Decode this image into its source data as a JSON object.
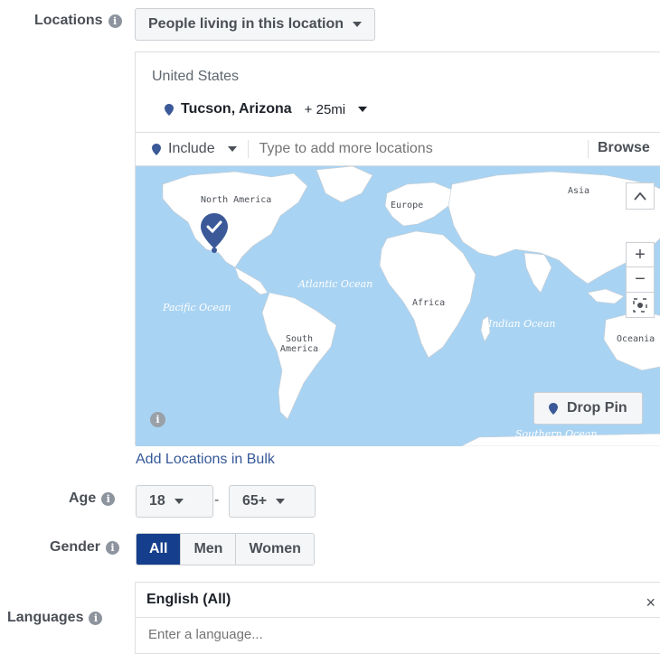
{
  "locations": {
    "label": "Locations",
    "dropdown_label": "People living in this location",
    "country": "United States",
    "selected_location": "Tucson, Arizona",
    "radius": "+ 25mi",
    "include_label": "Include",
    "search_placeholder": "Type to add more locations",
    "browse_label": "Browse",
    "bulk_link": "Add Locations in Bulk"
  },
  "map": {
    "labels": {
      "north_america": "North America",
      "europe": "Europe",
      "asia": "Asia",
      "atlantic": "Atlantic Ocean",
      "pacific": "Pacific Ocean",
      "africa": "Africa",
      "indian": "Indian Ocean",
      "south_america": "South America",
      "oceania": "Oceania",
      "southern": "Southern Ocean"
    },
    "drop_pin_label": "Drop Pin",
    "icons": [
      "chevron-up-icon",
      "zoom-in-icon",
      "zoom-out-icon",
      "locate-icon",
      "info-icon",
      "map-pin-icon"
    ]
  },
  "age": {
    "label": "Age",
    "min": "18",
    "separator": "-",
    "max": "65+"
  },
  "gender": {
    "label": "Gender",
    "options": [
      "All",
      "Men",
      "Women"
    ],
    "selected": "All"
  },
  "languages": {
    "label": "Languages",
    "selected": "English (All)",
    "remove_symbol": "×",
    "placeholder": "Enter a language..."
  },
  "colors": {
    "accent": "#153e8c",
    "link": "#365899",
    "pin": "#3b5998",
    "map_water": "#a9d3f2",
    "map_land": "#ffffff"
  }
}
